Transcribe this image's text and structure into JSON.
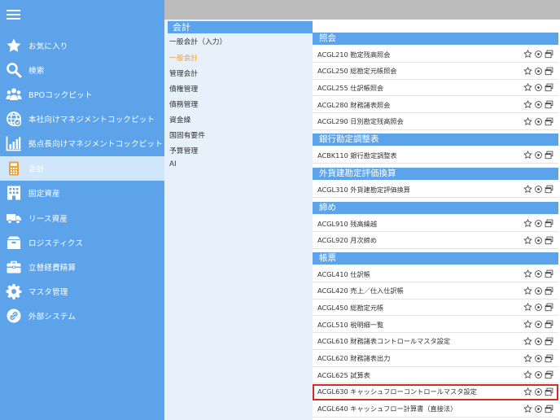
{
  "colors": {
    "sidebar_bg": "#5da3ea",
    "active_nav_bg": "#cfe6fb",
    "section_header_bg": "#5da3ea",
    "mid_bg": "#e6f1fc",
    "active_menu_text": "#f0a030",
    "highlight_border": "#d62b2b"
  },
  "sidebar": {
    "menu_icon": "hamburger-icon",
    "items": [
      {
        "label": "お気に入り",
        "icon": "star-icon"
      },
      {
        "label": "検索",
        "icon": "search-icon"
      },
      {
        "label": "BPOコックピット",
        "icon": "people-icon"
      },
      {
        "label": "本社向けマネジメントコックピット",
        "icon": "globe-icon"
      },
      {
        "label": "拠点長向けマネジメントコックピット",
        "icon": "bar-chart-icon"
      },
      {
        "label": "会計",
        "icon": "calculator-icon",
        "active": true
      },
      {
        "label": "固定資産",
        "icon": "building-icon"
      },
      {
        "label": "リース資産",
        "icon": "truck-icon"
      },
      {
        "label": "ロジスティクス",
        "icon": "box-icon"
      },
      {
        "label": "立替経費精算",
        "icon": "briefcase-icon"
      },
      {
        "label": "マスタ管理",
        "icon": "gear-icon"
      },
      {
        "label": "外部システム",
        "icon": "link-icon"
      }
    ]
  },
  "midcol": {
    "header": "会計",
    "items": [
      {
        "label": "一般会計（入力）"
      },
      {
        "label": "一般会計",
        "active": true
      },
      {
        "label": "管理会計"
      },
      {
        "label": "債権管理"
      },
      {
        "label": "債務管理"
      },
      {
        "label": "資金繰"
      },
      {
        "label": "国固有要件"
      },
      {
        "label": "予算管理"
      },
      {
        "label": "AI"
      }
    ]
  },
  "rightcol": {
    "sections": [
      {
        "title": "照会",
        "rows": [
          "ACGL210 勘定残高照会",
          "ACGL250 総勘定元帳照会",
          "ACGL255 仕訳帳照会",
          "ACGL280 財務諸表照会",
          "ACGL290 日別勘定残高照会"
        ]
      },
      {
        "title": "銀行勘定調整表",
        "rows": [
          "ACBK110 銀行勘定調整表"
        ]
      },
      {
        "title": "外貨建勘定評価換算",
        "rows": [
          "ACGL310 外貨建勘定評価換算"
        ]
      },
      {
        "title": "締め",
        "rows": [
          "ACGL910 残高繰越",
          "ACGL920 月次締め"
        ]
      },
      {
        "title": "帳票",
        "rows": [
          "ACGL410 仕訳帳",
          "ACGL420 売上／仕入仕訳帳",
          "ACGL450 総勘定元帳",
          "ACGL510 税明細一覧",
          "ACGL610 財務諸表コントロールマスタ設定",
          "ACGL620 財務諸表出力",
          "ACGL625 試算表",
          "ACGL630 キャッシュフローコントロールマスタ設定",
          "ACGL640 キャッシュフロー計算書（直接法）"
        ]
      }
    ],
    "highlighted_row": "ACGL630 キャッシュフローコントロールマスタ設定",
    "row_icons": [
      "star-outline-icon",
      "circle-dot-icon",
      "window-icon"
    ]
  }
}
